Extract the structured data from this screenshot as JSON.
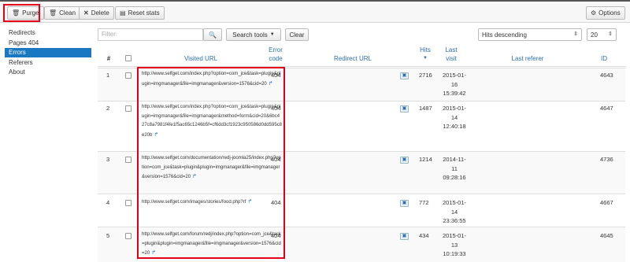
{
  "toolbar": {
    "purge": "Purge",
    "clean": "Clean",
    "delete": "Delete",
    "reset_stats": "Reset stats",
    "options": "Options"
  },
  "sidebar": {
    "items": [
      {
        "label": "Redirects",
        "active": false
      },
      {
        "label": "Pages 404",
        "active": false
      },
      {
        "label": "Errors",
        "active": true
      },
      {
        "label": "Referers",
        "active": false
      },
      {
        "label": "About",
        "active": false
      }
    ]
  },
  "filter": {
    "placeholder": "Filter:",
    "search_tools": "Search tools",
    "clear": "Clear",
    "sort": "Hits descending",
    "limit": "20"
  },
  "table": {
    "headers": {
      "num": "#",
      "visited_url": "Visited URL",
      "error_code_1": "Error",
      "error_code_2": "code",
      "redirect_url": "Redirect URL",
      "hits": "Hits",
      "last_visit_1": "Last",
      "last_visit_2": "visit",
      "last_referer": "Last referer",
      "id": "ID"
    },
    "rows": [
      {
        "num": "1",
        "url": "http://www.selfget.com/index.php?option=com_jce&task=plugin&plugin=imgmanager&file=imgmanager&version=1576&cid=20",
        "code": "404",
        "hits": "2716",
        "visit_1": "2015-01-",
        "visit_2": "16",
        "visit_3": "15:39:42",
        "id": "4643"
      },
      {
        "num": "2",
        "url": "http://www.selfget.com/index.php?option=com_jce&task=plugin&plugin=imgmanager&file=imgmanager&method=form&cid=20&6bc427c8a7981f4fe1f5ac65c1246b5f=cf6dd3cf1923c950586d0dd595c8e20b",
        "code": "404",
        "hits": "1487",
        "visit_1": "2015-01-",
        "visit_2": "14",
        "visit_3": "12:40:18",
        "id": "4647"
      },
      {
        "num": "3",
        "url": "http://www.selfget.com/documentation/redj-joomla25/index.php?option=com_jce&task=plugin&plugin=imgmanager&file=imgmanager&version=1576&cid=20",
        "code": "404",
        "hits": "1214",
        "visit_1": "2014-11-",
        "visit_2": "11",
        "visit_3": "09:28:16",
        "id": "4736"
      },
      {
        "num": "4",
        "url": "http://www.selfget.com/images/stories/food.php?rf",
        "code": "404",
        "hits": "772",
        "visit_1": "2015-01-",
        "visit_2": "14",
        "visit_3": "23:36:55",
        "id": "4667"
      },
      {
        "num": "5",
        "url": "http://www.selfget.com/forum/redj/index.php?option=com_jce&task=plugin&plugin=imgmanager&file=imgmanager&version=1576&cid=20",
        "code": "404",
        "hits": "434",
        "visit_1": "2015-01-",
        "visit_2": "13",
        "visit_3": "10:19:33",
        "id": "4645"
      }
    ]
  },
  "colors": {
    "accent": "#1a78c2",
    "link": "#2a6fb0",
    "highlight": "#e3001b"
  }
}
